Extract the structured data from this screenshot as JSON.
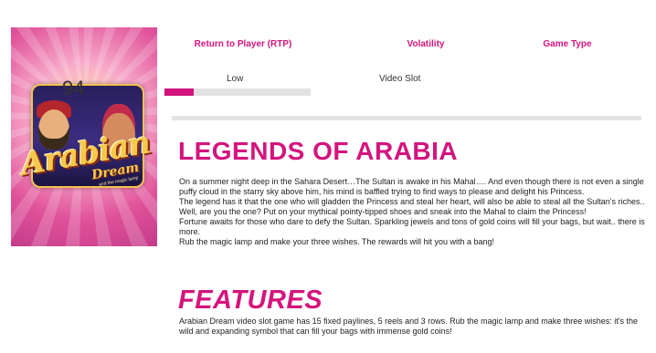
{
  "game": {
    "logo_text": "Arabian",
    "logo_sub": "Dream",
    "logo_tagline": "and the magic lamp"
  },
  "stats": {
    "rtp_label": "Return to Player (RTP)",
    "rtp_value": "94",
    "volatility_label": "Volatility",
    "volatility_value": "Low",
    "volatility_level": 0.2,
    "game_type_label": "Game Type",
    "game_type_value": "Video Slot"
  },
  "legends": {
    "title": "LEGENDS OF ARABIA",
    "paragraphs": [
      "On a summer night deep in the Sahara Desert…The Sultan is awake in his Mahal…. And even though there is not even a single puffy cloud in the starry sky above him, his mind is baffled trying to find ways to please and delight his Princess.",
      "The legend has it that the one who will gladden the Princess and steal her heart, will also be able to steal all the Sultan's riches..",
      "Well, are you the one? Put on your mythical pointy-tipped shoes and sneak into the Mahal to claim the Princess!",
      "Fortune awaits for those who dare to defy the Sultan. Sparkling jewels and tons of gold coins will fill your bags, but wait.. there is more.",
      "Rub the magic lamp and make your three wishes. The rewards will hit you with a bang!"
    ]
  },
  "features": {
    "title": "FEATURES",
    "text": "Arabian Dream video slot game has 15 fixed paylines, 5 reels and 3 rows. Rub the magic lamp and make three wishes: it's the wild and expanding symbol that can fill your bags with immense gold coins!"
  },
  "colors": {
    "accent": "#d4147d",
    "track": "#e2e2e2",
    "divider": "#e4e4e4"
  }
}
